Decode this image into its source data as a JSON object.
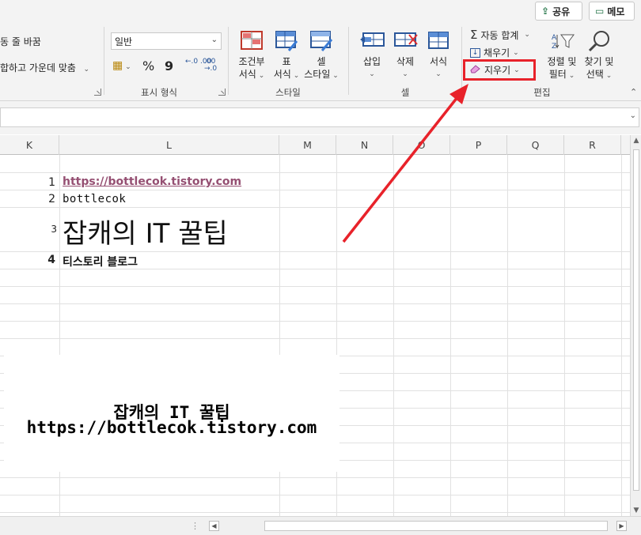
{
  "topbar": {
    "share_label": "공유",
    "memo_label": "메모"
  },
  "ribbon": {
    "alignment": {
      "wrap_text": "동 줄 바꿈",
      "merge_center": "합하고 가운데 맞춤"
    },
    "number": {
      "format_value": "일반",
      "percent": "%",
      "comma": "9",
      "inc_decimal": "←.0 .00",
      "dec_decimal": ".00 →.0",
      "group_label": "표시 형식"
    },
    "styles": {
      "conditional_line1": "조건부",
      "conditional_line2": "서식",
      "table_line1": "표",
      "table_line2": "서식",
      "cell_line1": "셀",
      "cell_line2": "스타일",
      "group_label": "스타일"
    },
    "cells": {
      "insert": "삽입",
      "delete": "삭제",
      "format": "서식",
      "group_label": "셀"
    },
    "editing": {
      "autosum": "자동 합계",
      "fill": "채우기",
      "clear": "지우기",
      "sort_line1": "정렬 및",
      "sort_line2": "필터",
      "find_line1": "찾기 및",
      "find_line2": "선택",
      "group_label": "편집"
    }
  },
  "grid": {
    "columns": [
      "K",
      "L",
      "M",
      "N",
      "O",
      "P",
      "Q",
      "R"
    ],
    "rows": [
      {
        "num": "1",
        "text": "https://bottlecok.tistory.com"
      },
      {
        "num": "2",
        "text": "bottlecok"
      },
      {
        "num": "3",
        "text": "잡캐의 IT 꿀팁"
      },
      {
        "num": "4",
        "text": "티스토리 블로그"
      }
    ],
    "overlay": {
      "title": "잡캐의 IT 꿀팁",
      "url": "https://bottlecok.tistory.com"
    }
  },
  "colors": {
    "accent_green": "#217346",
    "highlight_red": "#e8222a",
    "link_purple": "#954f72"
  },
  "icons": [
    "share-icon",
    "memo-icon",
    "dropdown-chevron-icon",
    "conditional-format-icon",
    "format-table-icon",
    "cell-style-icon",
    "insert-cells-icon",
    "delete-cells-icon",
    "format-cells-icon",
    "sigma-icon",
    "fill-down-icon",
    "eraser-icon",
    "sort-filter-icon",
    "magnifier-icon",
    "red-annotation-arrow"
  ]
}
